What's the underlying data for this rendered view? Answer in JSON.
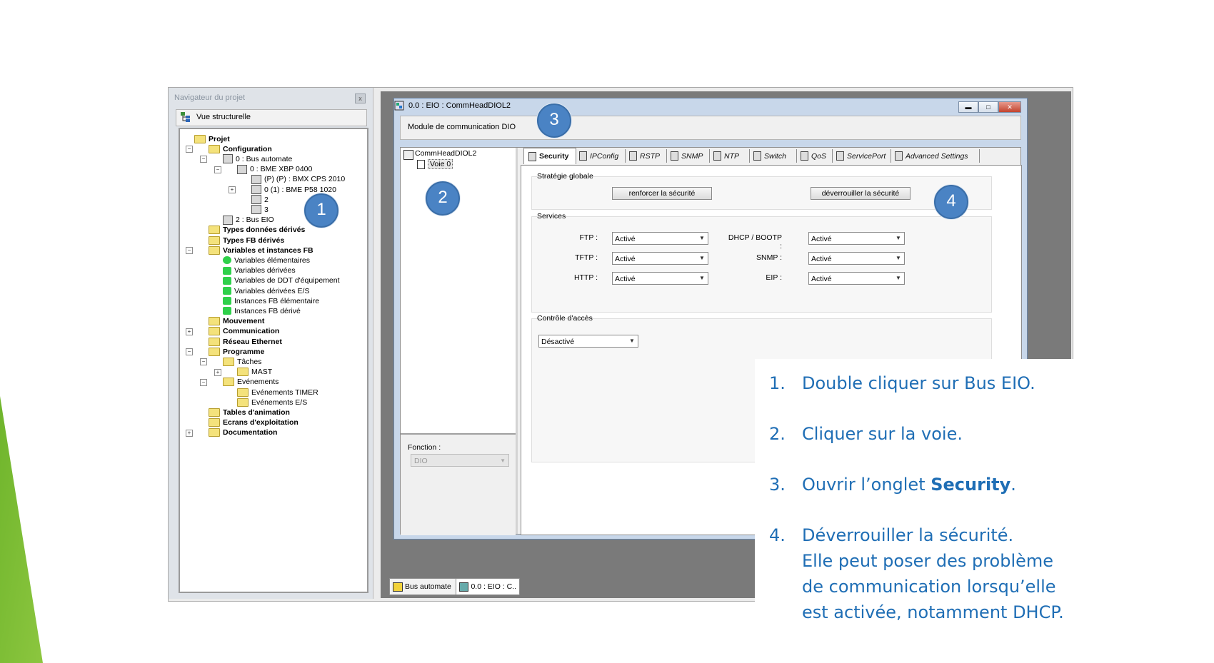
{
  "navigator": {
    "title": "Navigateur du projet",
    "close": "x",
    "view_label": "Vue structurelle",
    "tree": [
      {
        "label": "Projet",
        "bold": true
      },
      {
        "label": "Configuration",
        "bold": true
      },
      {
        "label": "0 : Bus automate",
        "bold": false
      },
      {
        "label": "0 : BME XBP 0400",
        "bold": false
      },
      {
        "label": "(P) (P) : BMX CPS 2010",
        "bold": false
      },
      {
        "label": "0 (1) : BME P58 1020",
        "bold": false
      },
      {
        "label": "2",
        "bold": false
      },
      {
        "label": "3",
        "bold": false
      },
      {
        "label": "2 : Bus EIO",
        "bold": false
      },
      {
        "label": "Types données dérivés",
        "bold": true
      },
      {
        "label": "Types FB dérivés",
        "bold": true
      },
      {
        "label": "Variables et instances FB",
        "bold": true
      },
      {
        "label": "Variables élémentaires",
        "bold": false
      },
      {
        "label": "Variables dérivées",
        "bold": false
      },
      {
        "label": "Variables de DDT d'équipement",
        "bold": false
      },
      {
        "label": "Variables dérivées E/S",
        "bold": false
      },
      {
        "label": "Instances FB élémentaire",
        "bold": false
      },
      {
        "label": "Instances FB dérivé",
        "bold": false
      },
      {
        "label": "Mouvement",
        "bold": true
      },
      {
        "label": "Communication",
        "bold": true
      },
      {
        "label": "Réseau Ethernet",
        "bold": true
      },
      {
        "label": "Programme",
        "bold": true
      },
      {
        "label": "Tâches",
        "bold": false
      },
      {
        "label": "MAST",
        "bold": false
      },
      {
        "label": "Evénements",
        "bold": false
      },
      {
        "label": "Evénements TIMER",
        "bold": false
      },
      {
        "label": "Evénements E/S",
        "bold": false
      },
      {
        "label": "Tables d'animation",
        "bold": true
      },
      {
        "label": "Ecrans d'exploitation",
        "bold": true
      },
      {
        "label": "Documentation",
        "bold": true
      }
    ]
  },
  "window": {
    "title": "0.0 : EIO : CommHeadDIOL2",
    "module_label": "Module de communication DIO",
    "minimize": "▬",
    "maximize": "□",
    "close": "✕"
  },
  "device_tree": {
    "root": "CommHeadDIOL2",
    "child": "Voie 0"
  },
  "fonction": {
    "label": "Fonction :",
    "value": "DIO"
  },
  "tabs": [
    "Security",
    "IPConfig",
    "RSTP",
    "SNMP",
    "NTP",
    "Switch",
    "QoS",
    "ServicePort",
    "Advanced Settings"
  ],
  "security": {
    "global_title": "Stratégie globale",
    "enforce_button": "renforcer la sécurité",
    "unlock_button": "déverrouiller la sécurité",
    "services_title": "Services",
    "services_left": [
      {
        "label": "FTP :",
        "value": "Activé"
      },
      {
        "label": "TFTP :",
        "value": "Activé"
      },
      {
        "label": "HTTP :",
        "value": "Activé"
      }
    ],
    "services_right": [
      {
        "label": "DHCP / BOOTP :",
        "value": "Activé"
      },
      {
        "label": "SNMP :",
        "value": "Activé"
      },
      {
        "label": "EIP :",
        "value": "Activé"
      }
    ],
    "access_title": "Contrôle d'accès",
    "access_value": "Désactivé"
  },
  "callouts": [
    "1",
    "2",
    "3",
    "4"
  ],
  "bottom_tabs": [
    "Bus automate",
    "0.0 : EIO : C..."
  ],
  "instructions": [
    {
      "num": "1.",
      "text": "Double cliquer sur Bus EIO."
    },
    {
      "num": "2.",
      "text": "Cliquer sur la voie."
    },
    {
      "num": "3.",
      "pre": "Ouvrir l’onglet ",
      "bold": "Security",
      "post": "."
    },
    {
      "num": "4.",
      "lines": [
        "Déverrouiller la sécurité.",
        "Elle peut poser des problème",
        "de communication lorsqu’elle",
        "est activée, notamment DHCP."
      ]
    }
  ],
  "colors": {
    "accent_green": "#8cc63f",
    "callout_blue": "#4a83c4",
    "instruction_blue": "#1f6eb5"
  }
}
